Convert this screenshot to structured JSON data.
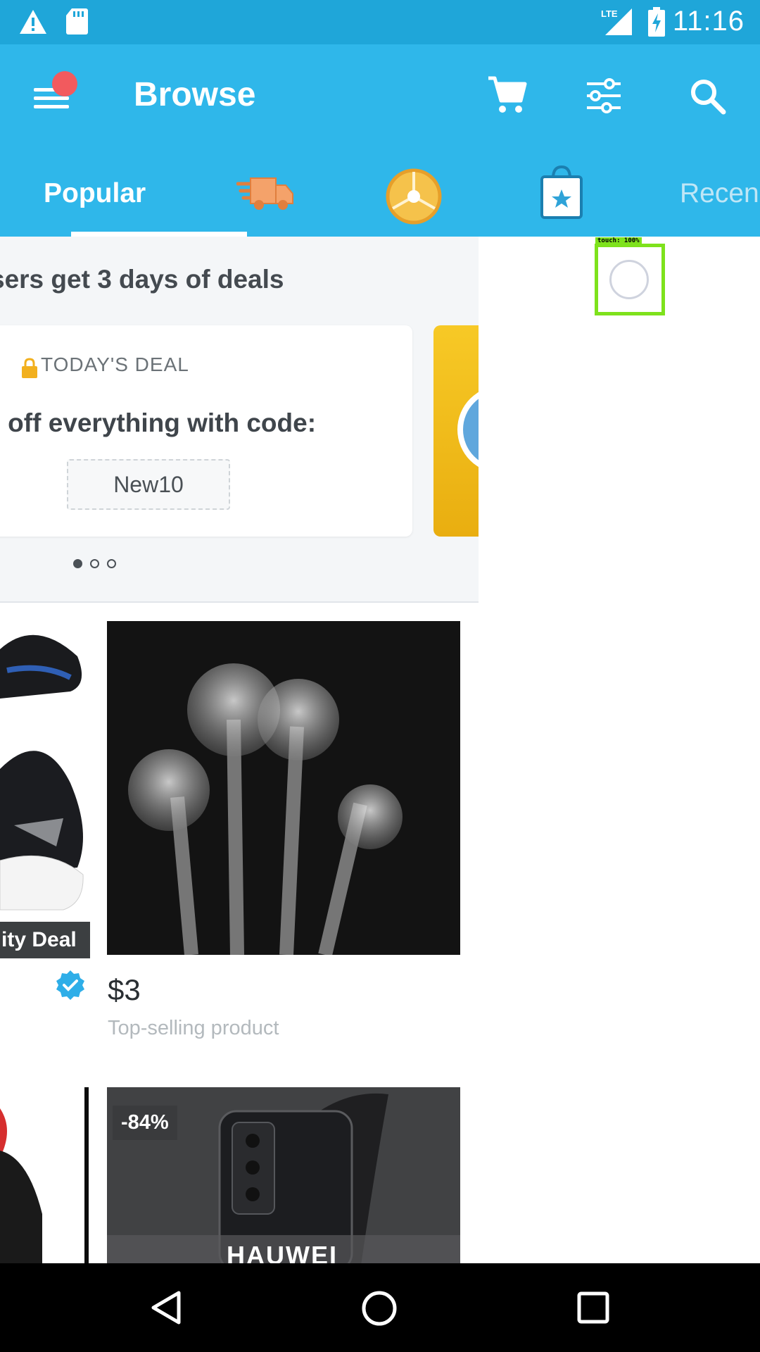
{
  "status_bar": {
    "time": "11:16",
    "network": "LTE"
  },
  "app_bar": {
    "title": "Browse"
  },
  "tabs": {
    "popular": "Popular",
    "recent": "Recen"
  },
  "banner": {
    "headline": "sers get 3 days of deals",
    "deal_label": "TODAY'S DEAL",
    "deal_text": "% off everything with code:",
    "code": "New10"
  },
  "products": [
    {
      "badge": "ity Deal"
    },
    {
      "price": "$3",
      "subtitle": "Top-selling product"
    },
    {
      "discount": "-84%",
      "brand": "HAUWEI"
    }
  ],
  "touch_overlay": {
    "label": "touch: 100%"
  },
  "colors": {
    "status_bar": "#1fa6d9",
    "app_bar": "#2fb7ea",
    "touch_green": "#7ee21c"
  }
}
